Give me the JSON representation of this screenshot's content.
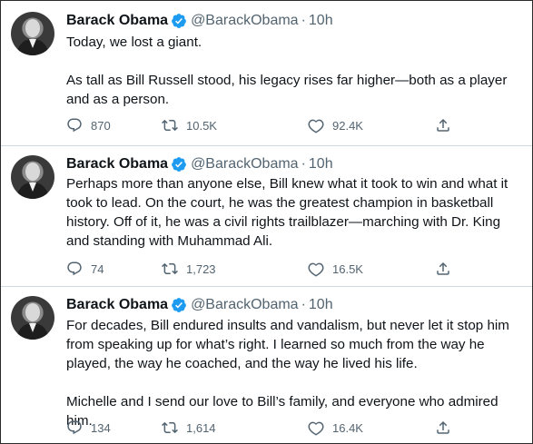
{
  "tweets": [
    {
      "name": "Barack Obama",
      "handle": "@BarackObama",
      "dot": "·",
      "time": "10h",
      "paragraphs": [
        "Today, we lost a giant.",
        "As tall as Bill Russell stood, his legacy rises far higher—both as a player and as a person."
      ],
      "replies": "870",
      "retweets": "10.5K",
      "likes": "92.4K"
    },
    {
      "name": "Barack Obama",
      "handle": "@BarackObama",
      "dot": "·",
      "time": "10h",
      "paragraphs": [
        "Perhaps more than anyone else, Bill knew what it took to win and what it took to lead. On the court, he was the greatest champion in basketball history. Off of it, he was a civil rights trailblazer—marching with Dr. King and standing with Muhammad Ali."
      ],
      "replies": "74",
      "retweets": "1,723",
      "likes": "16.5K"
    },
    {
      "name": "Barack Obama",
      "handle": "@BarackObama",
      "dot": "·",
      "time": "10h",
      "paragraphs": [
        "For decades, Bill endured insults and vandalism, but never let it stop him from speaking up for what’s right. I learned so much from the way he played, the way he coached, and the way he lived his life.",
        "Michelle and I send our love to Bill’s family, and everyone who admired him."
      ],
      "replies": "134",
      "retweets": "1,614",
      "likes": "16.4K"
    }
  ],
  "icons": {
    "avatar": "avatar",
    "verified": "verified-badge-icon",
    "reply": "reply-icon",
    "retweet": "retweet-icon",
    "like": "like-icon",
    "share": "share-icon"
  },
  "colors": {
    "verified": "#1d9bf0",
    "secondary_text": "#536471",
    "text": "#0f1419"
  }
}
